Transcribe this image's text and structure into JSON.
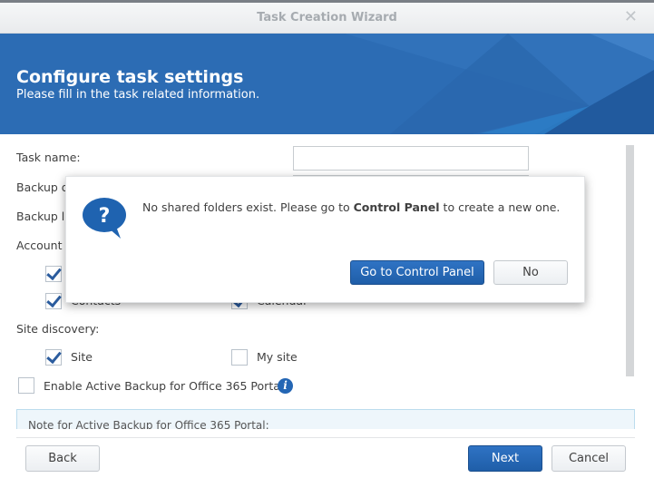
{
  "window": {
    "title": "Task Creation Wizard",
    "close_icon": "close-icon"
  },
  "header": {
    "title": "Configure task settings",
    "subtitle": "Please fill in the task related information."
  },
  "form": {
    "task_name_label": "Task name:",
    "task_name_value": "",
    "backup_dest_label": "Backup d",
    "backup_limit_label": "Backup li",
    "account_label": "Account",
    "contacts_label": "Contacts",
    "calendar_label": "Calendar",
    "site_discovery_label": "Site discovery:",
    "site_label": "Site",
    "site_checked": true,
    "mysite_label": "My site",
    "mysite_checked": false,
    "portal_label": "Enable Active Backup for Office 365 Portal",
    "portal_checked": false,
    "note_text": "Note for Active Backup for Office 365 Portal:"
  },
  "footer": {
    "back": "Back",
    "next": "Next",
    "cancel": "Cancel"
  },
  "dialog": {
    "msg_pre": "No shared folders exist. Please go to ",
    "msg_bold": "Control Panel",
    "msg_post": " to create a new one.",
    "confirm": "Go to Control Panel",
    "cancel": "No",
    "icon": "question-icon"
  },
  "colors": {
    "accent": "#2c6cb4",
    "primary_button": "#1f5ea8"
  }
}
